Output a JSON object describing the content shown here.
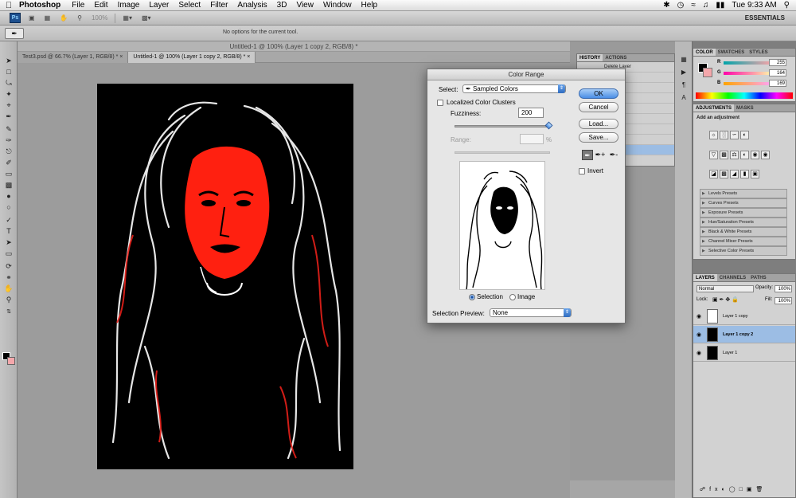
{
  "menubar": {
    "app_name": "Photoshop",
    "menus": [
      "File",
      "Edit",
      "Image",
      "Layer",
      "Select",
      "Filter",
      "Analysis",
      "3D",
      "View",
      "Window",
      "Help"
    ],
    "clock": "Tue 9:33 AM"
  },
  "appbar": {
    "zoom": "100%",
    "workspace": "ESSENTIALS"
  },
  "options": {
    "message": "No options for the current tool."
  },
  "window_title": "Untitled-1 @ 100% (Layer 1 copy 2, RGB/8) *",
  "tabs": [
    {
      "label": "Test3.psd @ 66.7% (Layer 1, RGB/8) *"
    },
    {
      "label": "Untitled-1 @ 100% (Layer 1 copy 2, RGB/8) *"
    }
  ],
  "history": {
    "tabs": [
      "HISTORY",
      "ACTIONS"
    ],
    "rows": [
      "Delete Layer",
      "Layer",
      "",
      "e",
      "",
      "rse",
      "",
      "",
      "Layer",
      ""
    ]
  },
  "color_panel": {
    "tabs": [
      "COLOR",
      "SWATCHES",
      "STYLES"
    ],
    "r": "255",
    "g": "164",
    "b": "169"
  },
  "adjustments": {
    "tabs": [
      "ADJUSTMENTS",
      "MASKS"
    ],
    "heading": "Add an adjustment",
    "presets": [
      "Levels Presets",
      "Curves Presets",
      "Exposure Presets",
      "Hue/Saturation Presets",
      "Black & White Presets",
      "Channel Mixer Presets",
      "Selective Color Presets"
    ]
  },
  "layers_panel": {
    "tabs": [
      "LAYERS",
      "CHANNELS",
      "PATHS"
    ],
    "blend_mode": "Normal",
    "opacity_label": "Opacity:",
    "opacity": "100%",
    "lock_label": "Lock:",
    "fill_label": "Fill:",
    "fill": "100%",
    "layers": [
      "Layer 1 copy",
      "Layer 1 copy 2",
      "Layer 1"
    ]
  },
  "dialog": {
    "title": "Color Range",
    "select_label": "Select:",
    "select_value": "Sampled Colors",
    "localized_label": "Localized Color Clusters",
    "fuzziness_label": "Fuzziness:",
    "fuzziness_value": "200",
    "range_label": "Range:",
    "range_unit": "%",
    "selection_label": "Selection",
    "image_label": "Image",
    "preview_label": "Selection Preview:",
    "preview_value": "None",
    "ok": "OK",
    "cancel": "Cancel",
    "load": "Load...",
    "save": "Save...",
    "invert": "Invert"
  },
  "colors": {
    "accent": "#4a8ee5",
    "foreground": "#000000",
    "background": "#f4a7ab",
    "highlight_red": "#ff2010"
  }
}
